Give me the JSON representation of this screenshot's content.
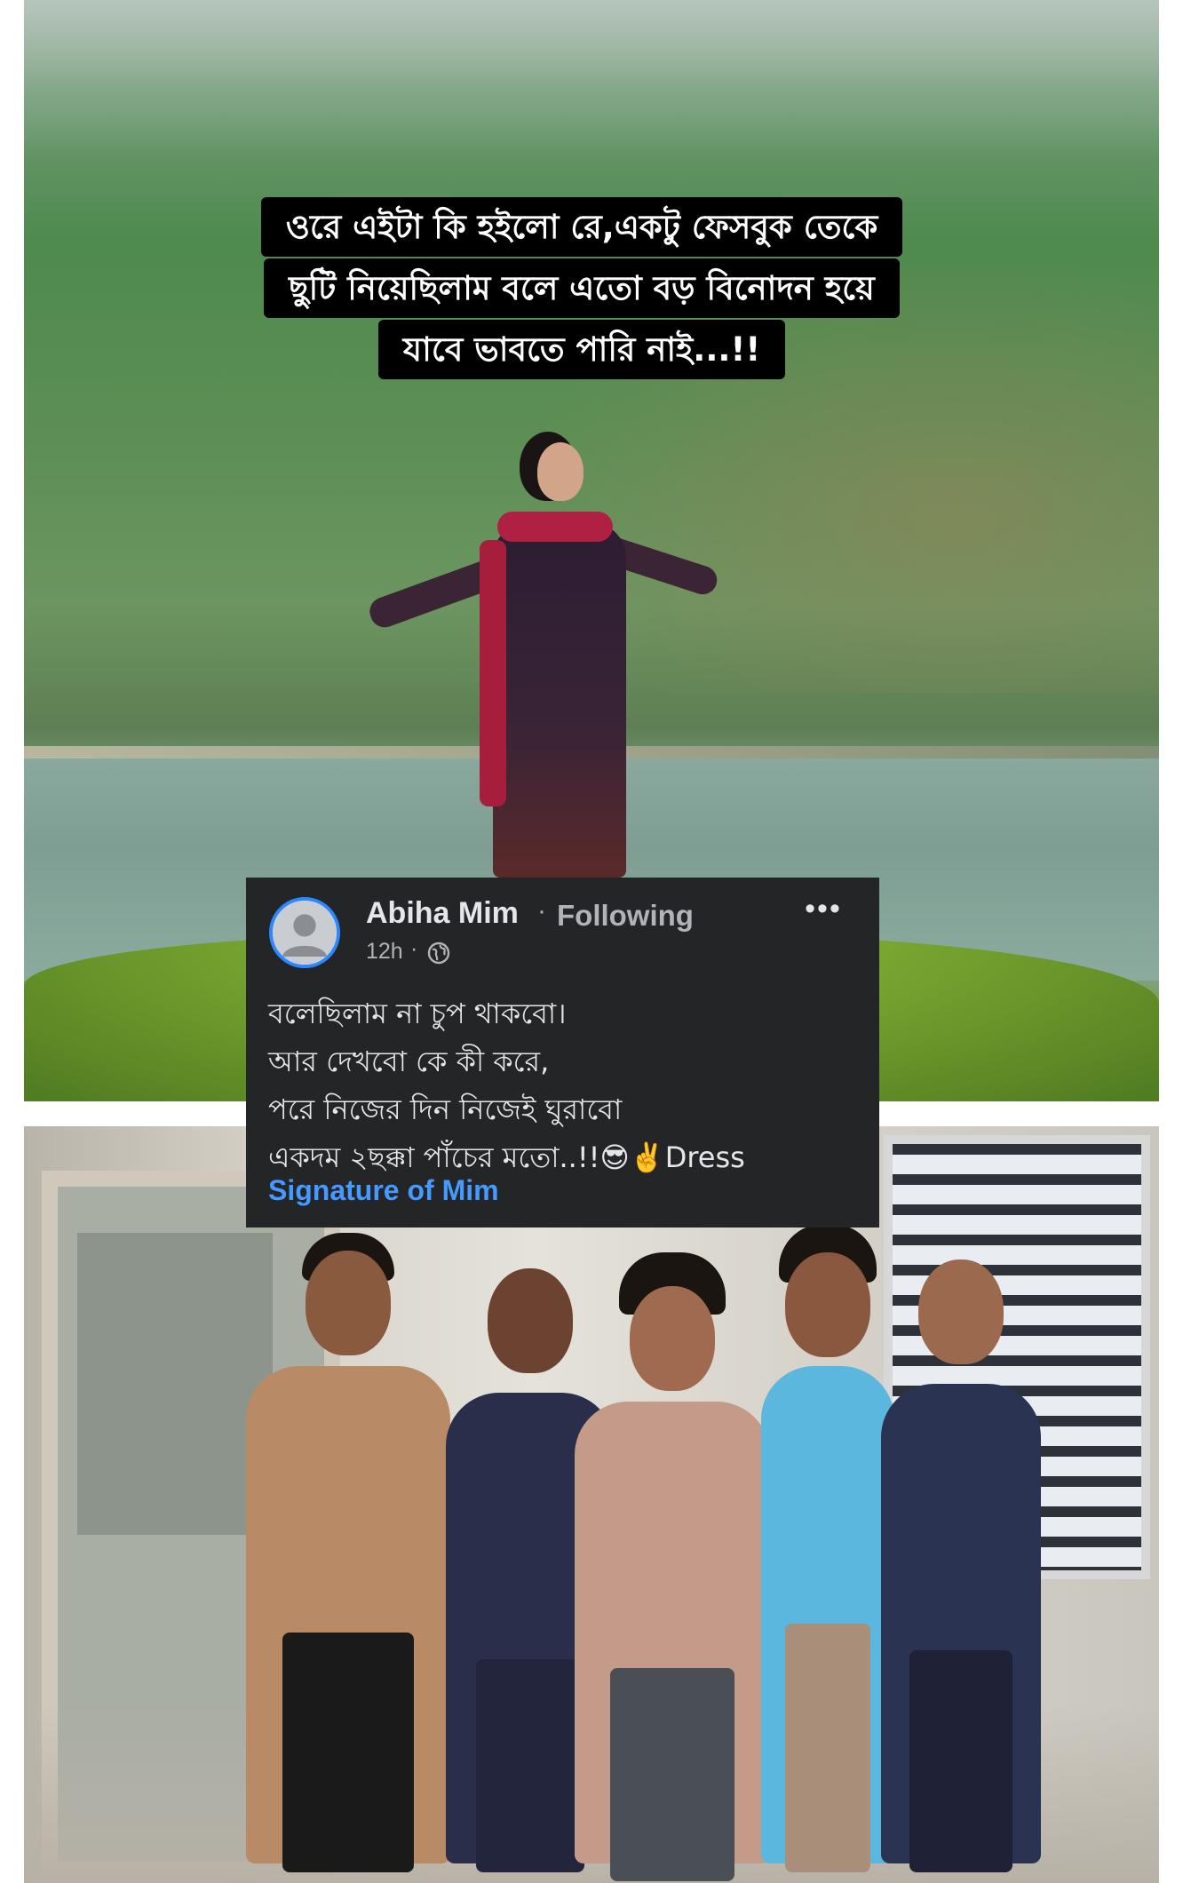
{
  "caption": {
    "lines": [
      "ওরে এইটা কি হইলো রে,একটু ফেসবুক তেকে",
      "ছুটি নিয়েছিলাম বলে এতো বড় বিনোদন হয়ে",
      "যাবে ভাবতে পারি নাই...!!"
    ]
  },
  "post": {
    "author": "Abiha Mim",
    "separator": "·",
    "follow_status": "Following",
    "time": "12h",
    "time_separator": "·",
    "privacy_icon": "globe-icon",
    "more_label": "•••",
    "body_lines": [
      "বলেছিলাম না চুপ থাকবো।",
      "আর দেখবো কে কী করে,",
      "পরে নিজের দিন নিজেই ঘুরাবো",
      "একদম ২ছক্কা পাঁচের মতো..!!😎✌️Dress"
    ],
    "link_text": "Signature of Mim",
    "colors": {
      "card_bg": "#242526",
      "text": "#e4e6eb",
      "muted": "#b0b3b8",
      "link": "#4599ff",
      "avatar_ring": "#2d88ff"
    }
  }
}
